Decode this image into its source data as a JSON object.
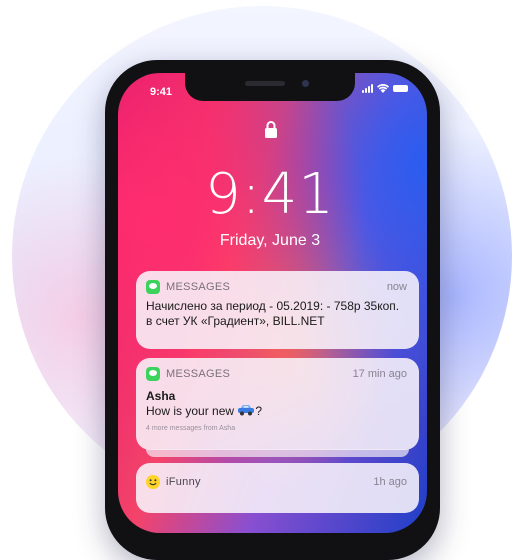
{
  "status_bar": {
    "time": "9:41",
    "icons": [
      "cellular-signal-icon",
      "wifi-icon",
      "battery-icon"
    ]
  },
  "lock_screen": {
    "lock_icon": "padlock-icon",
    "time": "9:41",
    "date": "Friday, June 3"
  },
  "notifications": [
    {
      "app": "MESSAGES",
      "icon": "messages-icon",
      "when": "now",
      "body_line1": "Начислено за период - 05.2019: - 758р 35коп.",
      "body_line2": "в счет УК «Градиент», BILL.NET"
    },
    {
      "app": "MESSAGES",
      "icon": "messages-icon",
      "when": "17 min ago",
      "sender": "Asha",
      "body_prefix": "How is your new ",
      "body_suffix": "?",
      "emoji": "car-emoji-icon",
      "more": "4 more messages from Asha"
    },
    {
      "app": "iFunny",
      "icon": "ifunny-smiley-icon",
      "when": "1h ago"
    }
  ],
  "colors": {
    "messages_green": "#3bd35c",
    "ifunny_yellow": "#ffd42a"
  }
}
